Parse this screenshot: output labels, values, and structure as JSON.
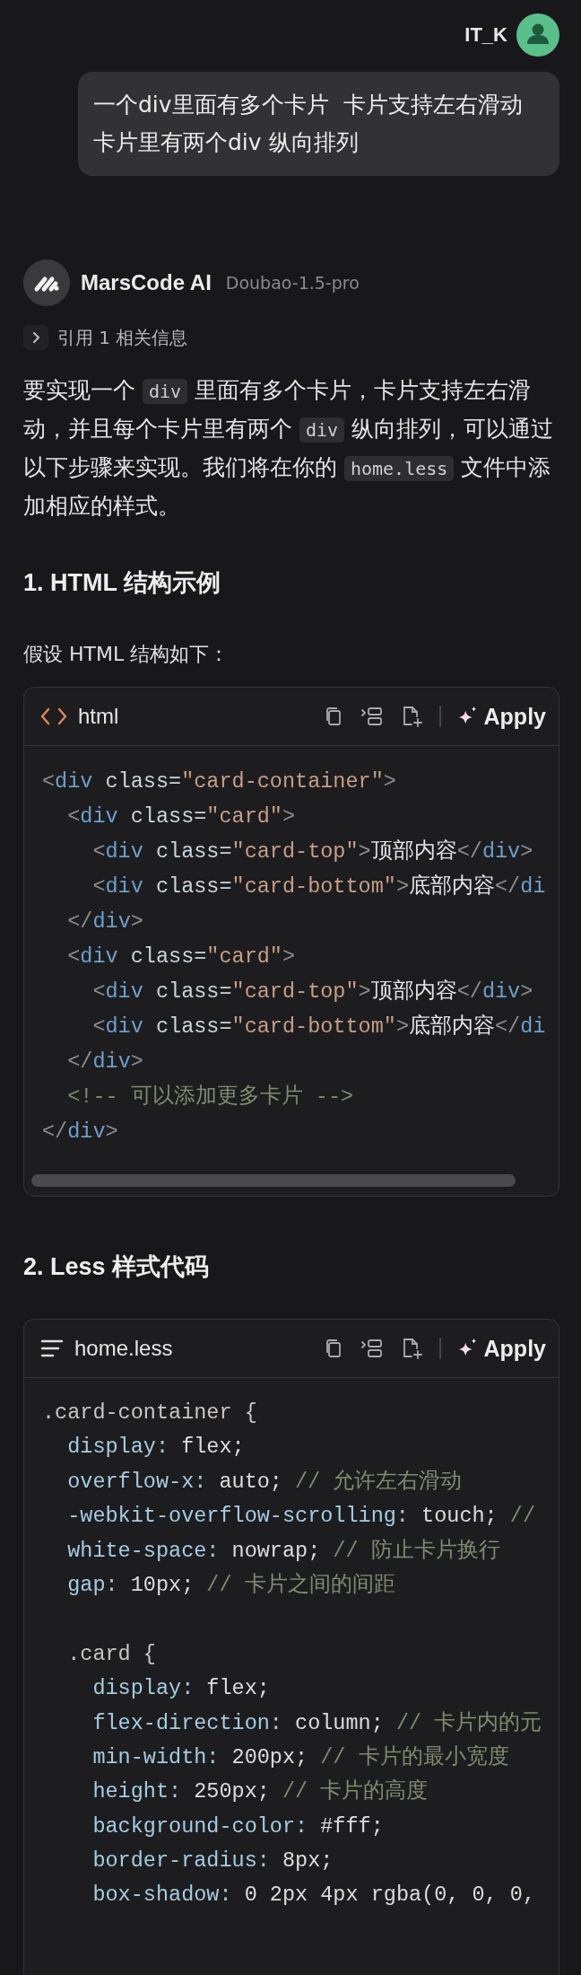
{
  "user": {
    "name": "IT_K"
  },
  "user_message": [
    "一个div里面有多个卡片  卡片支持左右滑动",
    "卡片里有两个div 纵向排列"
  ],
  "assistant": {
    "name": "MarsCode AI",
    "model": "Doubao-1.5-pro"
  },
  "reference": {
    "label": "引用 1 相关信息",
    "expanded": false
  },
  "intro": [
    {
      "kind": "text",
      "text": "要实现一个 "
    },
    {
      "kind": "code",
      "text": "div"
    },
    {
      "kind": "text",
      "text": " 里面有多个卡片，卡片支持左右滑动，并且每个卡片里有两个 "
    },
    {
      "kind": "code",
      "text": "div"
    },
    {
      "kind": "text",
      "text": " 纵向排列，可以通过以下步骤来实现。我们将在你的 "
    },
    {
      "kind": "code",
      "text": "home.less"
    },
    {
      "kind": "text",
      "text": " 文件中添加相应的样式。"
    }
  ],
  "sections": [
    {
      "heading": "1. HTML 结构示例",
      "text": "假设 HTML 结构如下：",
      "code": {
        "kind": "html",
        "language": "html",
        "apply": "Apply",
        "scrollbar": true,
        "lines": [
          [
            {
              "kind": "punct",
              "text": "<"
            },
            {
              "kind": "tag",
              "text": "div"
            },
            {
              "kind": "attr",
              "text": " class="
            },
            {
              "kind": "string",
              "text": "\"card-container\""
            },
            {
              "kind": "punct",
              "text": ">"
            }
          ],
          [
            {
              "kind": "punct",
              "text": "  <"
            },
            {
              "kind": "tag",
              "text": "div"
            },
            {
              "kind": "attr",
              "text": " class="
            },
            {
              "kind": "string",
              "text": "\"card\""
            },
            {
              "kind": "punct",
              "text": ">"
            }
          ],
          [
            {
              "kind": "punct",
              "text": "    <"
            },
            {
              "kind": "tag",
              "text": "div"
            },
            {
              "kind": "attr",
              "text": " class="
            },
            {
              "kind": "string",
              "text": "\"card-top\""
            },
            {
              "kind": "punct",
              "text": ">"
            },
            {
              "kind": "plain",
              "text": "顶部内容"
            },
            {
              "kind": "punct",
              "text": "</"
            },
            {
              "kind": "tag",
              "text": "div"
            },
            {
              "kind": "punct",
              "text": ">"
            }
          ],
          [
            {
              "kind": "punct",
              "text": "    <"
            },
            {
              "kind": "tag",
              "text": "div"
            },
            {
              "kind": "attr",
              "text": " class="
            },
            {
              "kind": "string",
              "text": "\"card-bottom\""
            },
            {
              "kind": "punct",
              "text": ">"
            },
            {
              "kind": "plain",
              "text": "底部内容"
            },
            {
              "kind": "punct",
              "text": "</"
            },
            {
              "kind": "tag",
              "text": "di"
            }
          ],
          [
            {
              "kind": "punct",
              "text": "  </"
            },
            {
              "kind": "tag",
              "text": "div"
            },
            {
              "kind": "punct",
              "text": ">"
            }
          ],
          [
            {
              "kind": "punct",
              "text": "  <"
            },
            {
              "kind": "tag",
              "text": "div"
            },
            {
              "kind": "attr",
              "text": " class="
            },
            {
              "kind": "string",
              "text": "\"card\""
            },
            {
              "kind": "punct",
              "text": ">"
            }
          ],
          [
            {
              "kind": "punct",
              "text": "    <"
            },
            {
              "kind": "tag",
              "text": "div"
            },
            {
              "kind": "attr",
              "text": " class="
            },
            {
              "kind": "string",
              "text": "\"card-top\""
            },
            {
              "kind": "punct",
              "text": ">"
            },
            {
              "kind": "plain",
              "text": "顶部内容"
            },
            {
              "kind": "punct",
              "text": "</"
            },
            {
              "kind": "tag",
              "text": "div"
            },
            {
              "kind": "punct",
              "text": ">"
            }
          ],
          [
            {
              "kind": "punct",
              "text": "    <"
            },
            {
              "kind": "tag",
              "text": "div"
            },
            {
              "kind": "attr",
              "text": " class="
            },
            {
              "kind": "string",
              "text": "\"card-bottom\""
            },
            {
              "kind": "punct",
              "text": ">"
            },
            {
              "kind": "plain",
              "text": "底部内容"
            },
            {
              "kind": "punct",
              "text": "</"
            },
            {
              "kind": "tag",
              "text": "di"
            }
          ],
          [
            {
              "kind": "punct",
              "text": "  </"
            },
            {
              "kind": "tag",
              "text": "div"
            },
            {
              "kind": "punct",
              "text": ">"
            }
          ],
          [
            {
              "kind": "comment",
              "text": "  <!-- 可以添加更多卡片 -->"
            }
          ],
          [
            {
              "kind": "punct",
              "text": "</"
            },
            {
              "kind": "tag",
              "text": "div"
            },
            {
              "kind": "punct",
              "text": ">"
            }
          ]
        ]
      }
    },
    {
      "heading": "2. Less 样式代码",
      "code": {
        "kind": "file",
        "language": "home.less",
        "apply": "Apply",
        "scrollbar": false,
        "lines": [
          [
            {
              "kind": "selector",
              "text": ".card-container {"
            }
          ],
          [
            {
              "kind": "prop",
              "text": "  display:"
            },
            {
              "kind": "value",
              "text": " flex;"
            }
          ],
          [
            {
              "kind": "prop",
              "text": "  overflow-x:"
            },
            {
              "kind": "value",
              "text": " auto;"
            },
            {
              "kind": "comment",
              "text": " // 允许左右滑动"
            }
          ],
          [
            {
              "kind": "prop",
              "text": "  -webkit-overflow-scrolling:"
            },
            {
              "kind": "value",
              "text": " touch;"
            },
            {
              "kind": "comment",
              "text": " //"
            }
          ],
          [
            {
              "kind": "prop",
              "text": "  white-space:"
            },
            {
              "kind": "value",
              "text": " nowrap;"
            },
            {
              "kind": "comment",
              "text": " // 防止卡片换行"
            }
          ],
          [
            {
              "kind": "prop",
              "text": "  gap:"
            },
            {
              "kind": "value",
              "text": " 10px;"
            },
            {
              "kind": "comment",
              "text": " // 卡片之间的间距"
            }
          ],
          {
            "kind": "blank"
          },
          [
            {
              "kind": "selector",
              "text": "  .card {"
            }
          ],
          [
            {
              "kind": "prop",
              "text": "    display:"
            },
            {
              "kind": "value",
              "text": " flex;"
            }
          ],
          [
            {
              "kind": "prop",
              "text": "    flex-direction:"
            },
            {
              "kind": "value",
              "text": " column;"
            },
            {
              "kind": "comment",
              "text": " // 卡片内的元"
            }
          ],
          [
            {
              "kind": "prop",
              "text": "    min-width:"
            },
            {
              "kind": "value",
              "text": " 200px;"
            },
            {
              "kind": "comment",
              "text": " // 卡片的最小宽度"
            }
          ],
          [
            {
              "kind": "prop",
              "text": "    height:"
            },
            {
              "kind": "value",
              "text": " 250px;"
            },
            {
              "kind": "comment",
              "text": " // 卡片的高度"
            }
          ],
          [
            {
              "kind": "prop",
              "text": "    background-color:"
            },
            {
              "kind": "value",
              "text": " #fff;"
            }
          ],
          [
            {
              "kind": "prop",
              "text": "    border-radius:"
            },
            {
              "kind": "value",
              "text": " 8px;"
            }
          ],
          [
            {
              "kind": "prop",
              "text": "    box-shadow:"
            },
            {
              "kind": "value",
              "text": " 0 2px 4px rgba(0, 0, 0,"
            }
          ]
        ]
      }
    }
  ]
}
